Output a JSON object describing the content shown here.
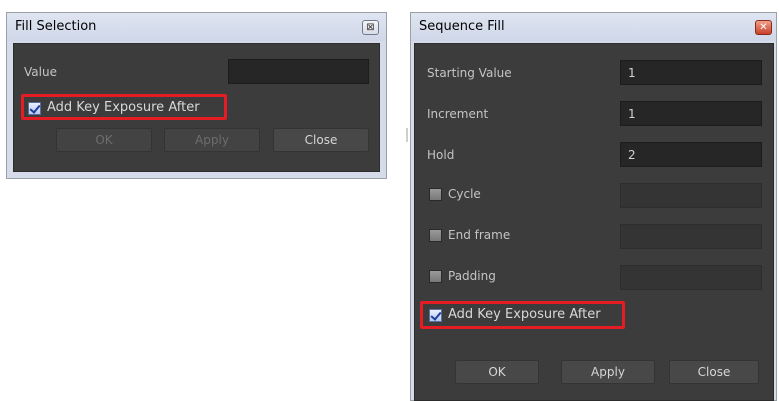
{
  "fill_selection": {
    "title": "Fill Selection",
    "close_glyph": "⊠",
    "value_label": "Value",
    "value_field": "",
    "add_key_exposure_label": "Add Key Exposure After",
    "add_key_exposure_checked": true,
    "ok_label": "OK",
    "apply_label": "Apply",
    "close_label": "Close"
  },
  "sequence_fill": {
    "title": "Sequence Fill",
    "close_glyph": "✕",
    "starting_value_label": "Starting Value",
    "starting_value": "1",
    "increment_label": "Increment",
    "increment": "1",
    "hold_label": "Hold",
    "hold": "2",
    "cycle_label": "Cycle",
    "end_frame_label": "End frame",
    "padding_label": "Padding",
    "add_key_exposure_label": "Add Key Exposure After",
    "add_key_exposure_checked": true,
    "ok_label": "OK",
    "apply_label": "Apply",
    "close_label": "Close"
  },
  "colors": {
    "highlight": "#e51c23",
    "panel_bg": "#3c3c3c",
    "title_bg": "#d6dbe9"
  }
}
